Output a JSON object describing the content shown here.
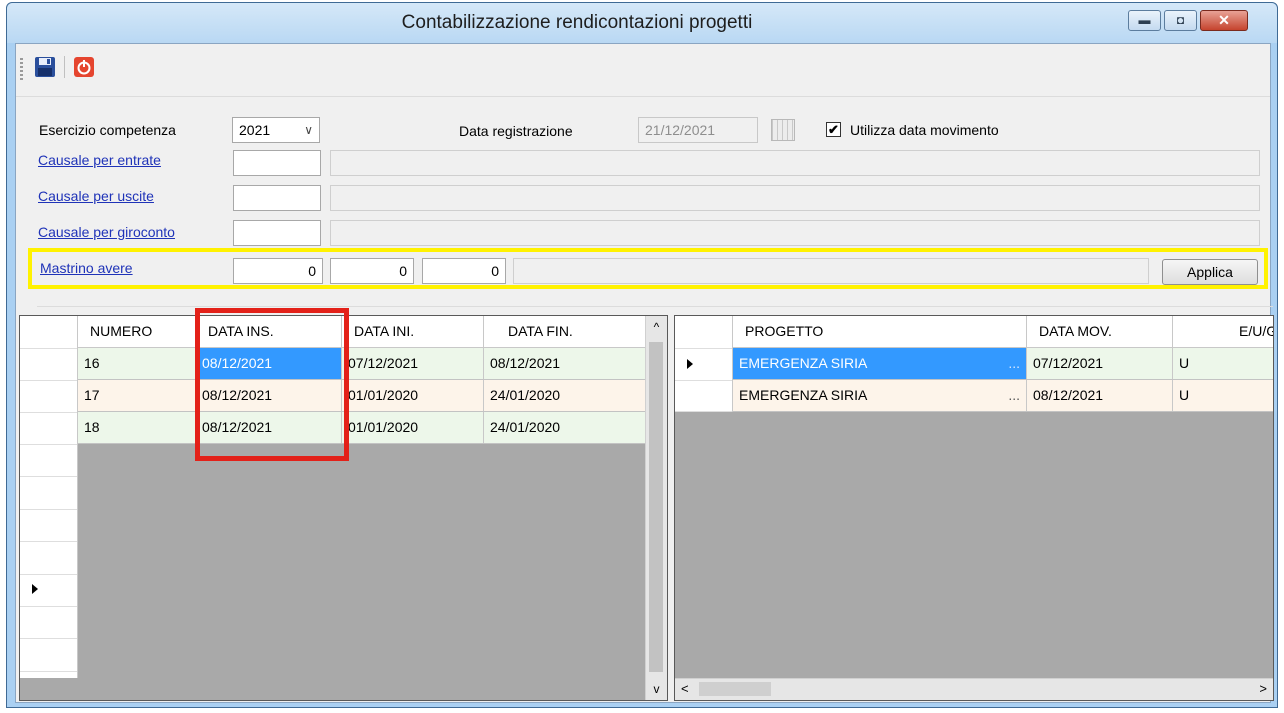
{
  "window": {
    "title": "Contabilizzazione rendicontazioni progetti",
    "minimize_glyph": "▬",
    "maximize_glyph": "◘",
    "close_glyph": "✕"
  },
  "toolbar": {
    "save_icon": "floppy-disk-icon",
    "exit_icon": "power-exit-icon"
  },
  "form": {
    "esercizio_label": "Esercizio competenza",
    "esercizio_value": "2021",
    "data_registrazione_label": "Data registrazione",
    "data_registrazione_value": "21/12/2021",
    "utilizza_label": "Utilizza data movimento",
    "utilizza_checked": "✔",
    "causale_entrate_label": "Causale per entrate",
    "causale_uscite_label": "Causale per uscite",
    "causale_giroconto_label": "Causale per giroconto",
    "mastrino_label": "Mastrino avere",
    "mastrino_values": [
      "0",
      "0",
      "0"
    ],
    "applica_label": "Applica"
  },
  "left_grid": {
    "columns": [
      "NUMERO",
      "DATA INS.",
      "DATA INI.",
      "DATA FIN."
    ],
    "rows": [
      [
        "16",
        "08/12/2021",
        "07/12/2021",
        "08/12/2021"
      ],
      [
        "17",
        "08/12/2021",
        "01/01/2020",
        "24/01/2020"
      ],
      [
        "18",
        "08/12/2021",
        "01/01/2020",
        "24/01/2020"
      ]
    ],
    "scroll_up": "^",
    "scroll_down": "v"
  },
  "right_grid": {
    "columns": [
      "PROGETTO",
      "DATA MOV.",
      "E/U/G"
    ],
    "rows": [
      [
        "EMERGENZA SIRIA",
        "07/12/2021",
        "U"
      ],
      [
        "EMERGENZA SIRIA",
        "08/12/2021",
        "U"
      ]
    ],
    "ellipsis": "...",
    "scroll_left": "<",
    "scroll_right": ">"
  },
  "colors": {
    "highlight_yellow": "#fff200",
    "highlight_red": "#e32119",
    "selection_blue": "#3399ff",
    "link_blue": "#1f33b8"
  }
}
